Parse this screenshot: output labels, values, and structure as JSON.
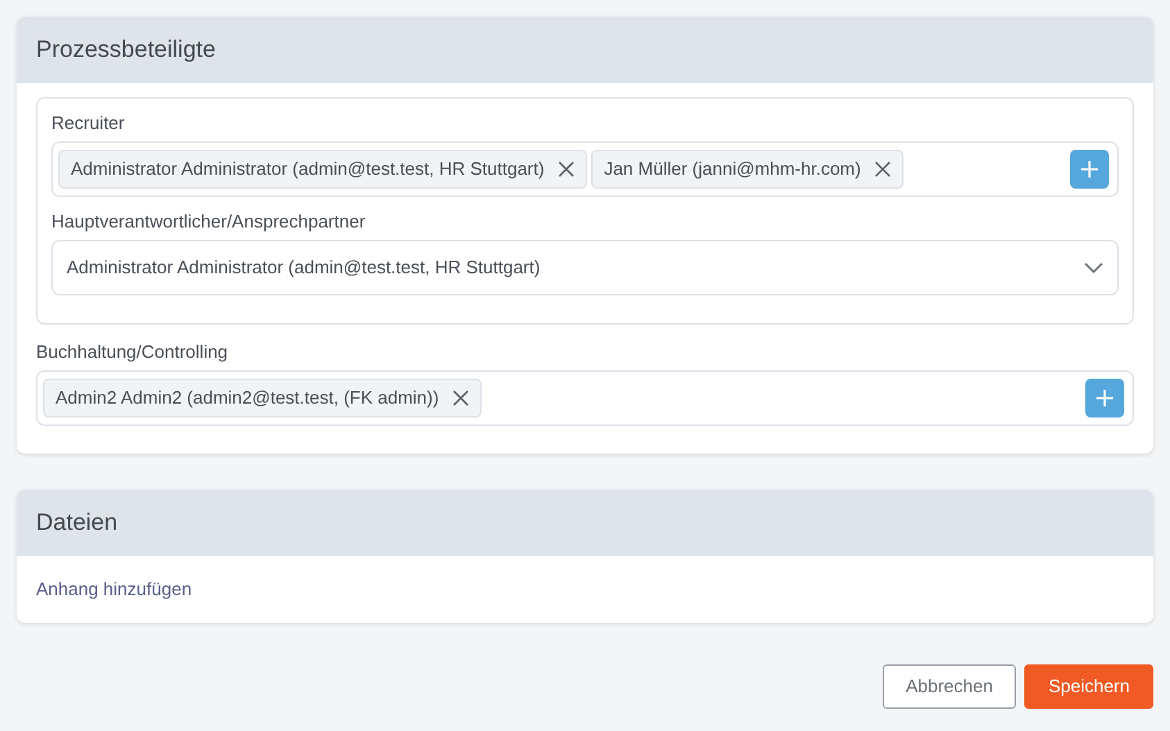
{
  "sections": [
    {
      "title": "Prozessbeteiligte",
      "groups": [
        {
          "boxed": true,
          "fields": [
            {
              "kind": "tags",
              "label": "Recruiter",
              "tags": [
                "Administrator Administrator (admin@test.test, HR Stuttgart)",
                "Jan Müller (janni@mhm-hr.com)"
              ]
            },
            {
              "kind": "select",
              "label": "Hauptverantwortlicher/Ansprechpartner",
              "value": "Administrator Administrator (admin@test.test, HR Stuttgart)"
            }
          ]
        },
        {
          "boxed": false,
          "fields": [
            {
              "kind": "tags",
              "label": "Buchhaltung/Controlling",
              "tags": [
                "Admin2 Admin2 (admin2@test.test, (FK admin))"
              ]
            }
          ]
        }
      ]
    },
    {
      "title": "Dateien",
      "link": "Anhang hinzufügen"
    }
  ],
  "buttons": [
    {
      "kind": "secondary",
      "label": "Abbrechen"
    },
    {
      "kind": "primary",
      "label": "Speichern"
    }
  ]
}
